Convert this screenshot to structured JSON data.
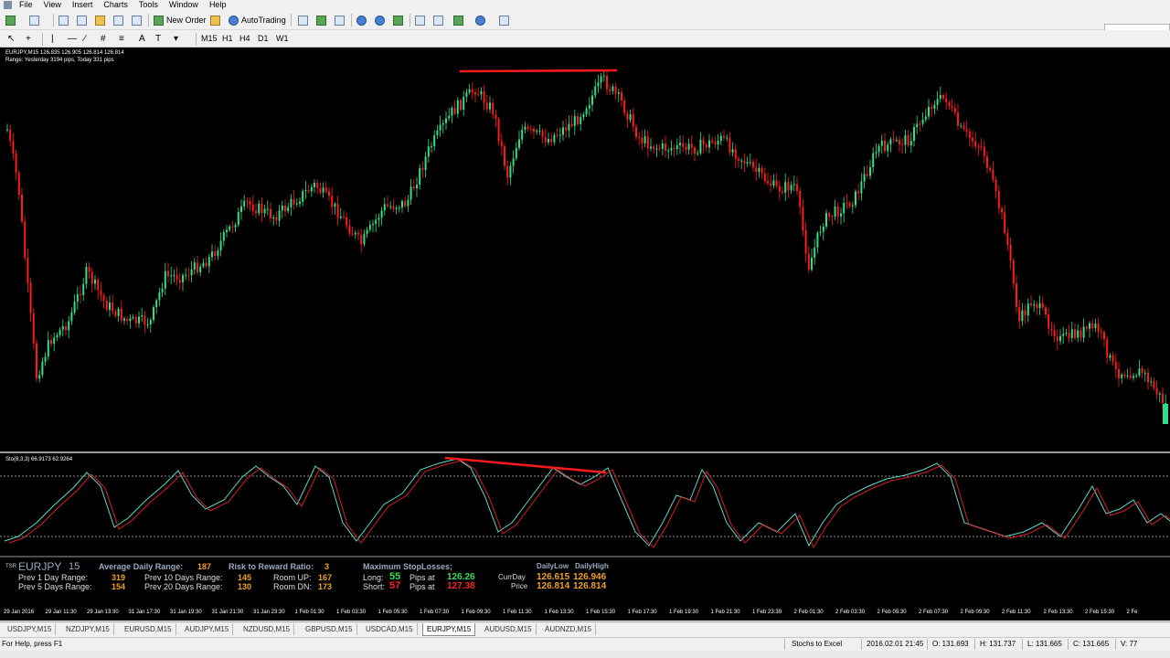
{
  "menu": [
    "File",
    "View",
    "Insert",
    "Charts",
    "Tools",
    "Window",
    "Help"
  ],
  "toolbar": {
    "new_order": "New Order",
    "auto_trading": "AutoTrading",
    "timeframes": [
      "M15",
      "H1",
      "H4",
      "D1",
      "W1"
    ]
  },
  "chart": {
    "symbol_line": "EURJPY,M15  126.835 126.905 126.814 126.814",
    "range_line": "Range: Yesterday 3194 pips, Today 331 pips",
    "stoch_label": "Sto(8,3,3) 66.9173 62.9264",
    "time_axis": [
      "29 Jan 2016",
      "29 Jan 11:30",
      "29 Jan 13:30",
      "31 Jan 17:30",
      "31 Jan 19:30",
      "31 Jan 21:30",
      "31 Jan 23:30",
      "1 Feb 01:30",
      "1 Feb 03:30",
      "1 Feb 05:30",
      "1 Feb 07:30",
      "1 Feb 09:30",
      "1 Feb 11:30",
      "1 Feb 13:30",
      "1 Feb 15:30",
      "1 Feb 17:30",
      "1 Feb 19:30",
      "1 Feb 21:30",
      "1 Feb 23:30",
      "2 Feb 01:30",
      "2 Feb 03:30",
      "2 Feb 05:30",
      "2 Feb 07:30",
      "2 Feb 09:30",
      "2 Feb 11:30",
      "2 Feb 13:30",
      "2 Feb 15:30",
      "2 Fe"
    ],
    "colors": {
      "bull": "#33dd88",
      "bear": "#ff1a1a",
      "stoch_main": "#5fd7c8",
      "stoch_signal": "#d62020",
      "trendline": "#ff1a1a"
    }
  },
  "info_panel": {
    "tsr": "TSR",
    "symbol": "EURJPY",
    "tf": "15",
    "adr_label": "Average Daily Range:",
    "adr_value": "187",
    "rr_label": "Risk to Reward Ratio:",
    "rr_value": "3",
    "max_sl_label": "Maximum StopLosses;",
    "prev1_label": "Prev 1 Day Range:",
    "prev1_value": "319",
    "prev10_label": "Prev 10 Days Range:",
    "prev10_value": "145",
    "room_up_label": "Room UP:",
    "room_up_value": "167",
    "long_label": "Long:",
    "long_value": "55",
    "long_pips_label": "Pips at",
    "long_price": "126.26",
    "prev5_label": "Prev 5 Days Range:",
    "prev5_value": "154",
    "prev20_label": "Prev 20 Days Range:",
    "prev20_value": "130",
    "room_dn_label": "Room DN:",
    "room_dn_value": "173",
    "short_label": "Short:",
    "short_value": "57",
    "short_pips_label": "Pips at",
    "short_price": "127.38",
    "daily_low_label": "DailyLow",
    "daily_high_label": "DailyHigh",
    "currday_label": "CurrDay",
    "currday_low": "126.615",
    "currday_high": "126.946",
    "price_label": "Price",
    "price_low": "126.814",
    "price_high": "126.814"
  },
  "tabs": [
    "USDJPY,M15",
    "NZDJPY,M15",
    "EURUSD,M15",
    "AUDJPY,M15",
    "NZDUSD,M15",
    "GBPUSD,M15",
    "USDCAD,M15",
    "EURJPY,M15",
    "AUDUSD,M15",
    "AUDNZD,M15"
  ],
  "active_tab": "EURJPY,M15",
  "status": {
    "help": "For Help, press F1",
    "profile": "Stochs to Excel",
    "datetime": "2016.02.01 21:45",
    "open": "O: 131.693",
    "high": "H: 131.737",
    "low": "L: 131.665",
    "close": "C: 131.665",
    "volume": "V: 77"
  }
}
